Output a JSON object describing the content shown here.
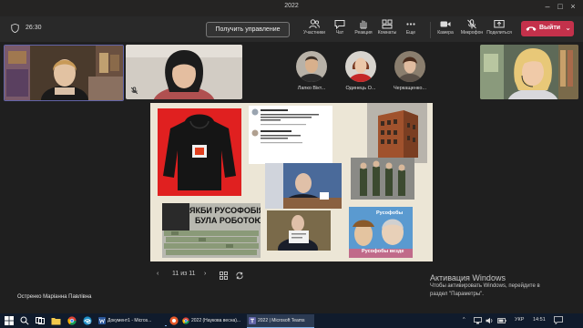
{
  "window": {
    "title": "2022"
  },
  "toolbar": {
    "timer": "26:30",
    "take_control_label": "Получить управление",
    "items": [
      {
        "id": "participants",
        "label": "Участники"
      },
      {
        "id": "chat",
        "label": "Чат"
      },
      {
        "id": "reactions",
        "label": "Реакция"
      },
      {
        "id": "rooms",
        "label": "Комнаты"
      },
      {
        "id": "more",
        "label": "Еще"
      },
      {
        "id": "camera",
        "label": "Камера"
      },
      {
        "id": "mic",
        "label": "Микрофон"
      },
      {
        "id": "share",
        "label": "Поделиться"
      }
    ],
    "leave_label": "Выйти",
    "leave_color": "#c4314b"
  },
  "participants": {
    "avatars": [
      {
        "name": "Лапко Вікт..."
      },
      {
        "name": "Одинець О..."
      },
      {
        "name": "Черкащенко..."
      }
    ]
  },
  "slide": {
    "meme_text_1": "ЯКБИ РУСОФОБІЯ",
    "meme_text_2": "БУЛА РОБОТОЮ",
    "toy_text_top": "Русофобы",
    "toy_text_bottom": "Русофобы везде",
    "nav_counter": "11 из 11"
  },
  "presenter": {
    "name": "Остренко Маріанна Павлівна"
  },
  "activation": {
    "heading": "Активация Windows",
    "line1": "Чтобы активировать Windows, перейдите в",
    "line2": "раздел \"Параметры\"."
  },
  "taskbar": {
    "tasks": [
      {
        "label": "Документ1 - Micros..."
      },
      {
        "label": "2022 (Наукова весна)..."
      },
      {
        "label": "2022 | Microsoft Teams"
      }
    ],
    "lang": "УКР",
    "time": "14:51"
  }
}
